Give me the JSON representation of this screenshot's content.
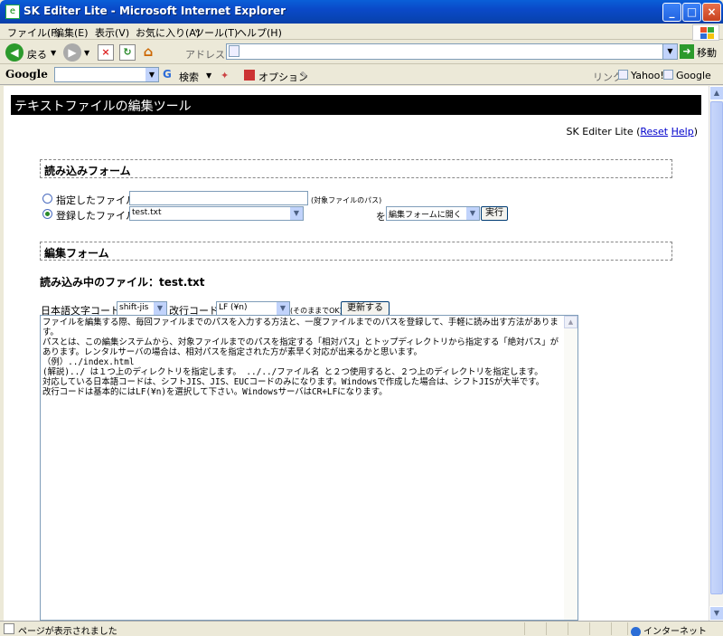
{
  "window": {
    "title": "SK Editer Lite - Microsoft Internet Explorer"
  },
  "menu": [
    "ファイル(F)",
    "編集(E)",
    "表示(V)",
    "お気に入り(A)",
    "ツール(T)",
    "ヘルプ(H)"
  ],
  "toolbar": {
    "back_label": "戻る",
    "address_label": "アドレス(D)",
    "go_label": "移動"
  },
  "google_bar": {
    "logo": "Google",
    "search_label": "検索",
    "options_label": "オプション",
    "links_label": "リンク",
    "link_yahoo": "Yahoo!",
    "link_google": "Google"
  },
  "page": {
    "banner": "テキストファイルの編集ツール",
    "credit_prefix": "SK Editer Lite (",
    "reset_link": "Reset",
    "help_link": "Help",
    "credit_suffix": ")",
    "read_form_title": "読み込みフォーム",
    "specified_file_label": "指定したファイル",
    "specified_file_value": "",
    "target_path_hint": "(対象ファイルのパス)",
    "registered_file_label": "登録したファイル",
    "registered_file_value": "test.txt",
    "wo_label": "を",
    "action_select_value": "編集フォームに開く",
    "execute_button": "実行",
    "edit_form_title": "編集フォーム",
    "loading_file_label": "読み込み中のファイル：test.txt",
    "charset_label": "日本語文字コード",
    "charset_value": "shift-jis",
    "newline_label": "改行コード",
    "newline_value": "LF (¥n)",
    "keep_note": "(そのままでOK)",
    "update_button": "更新する",
    "textarea_content": "ファイルを編集する際、毎回ファイルまでのパスを入力する方法と、一度ファイルまでのパスを登録して、手軽に読み出す方法があります。\nパスとは、この編集システムから、対象ファイルまでのパスを指定する「相対パス」とトップディレクトリから指定する「絶対パス」があります。レンタルサーバの場合は、相対パスを指定された方が素早く対応が出来るかと思います。\n（例）../index.html\n(解説)../ は１つ上のディレクトリを指定します。 ../../ファイル名 と２つ使用すると、２つ上のディレクトリを指定します。\n対応している日本語コードは、シフトJIS、JIS、EUCコードのみになります。Windowsで作成した場合は、シフトJISが大半です。\n改行コードは基本的にはLF(¥n)を選択して下さい。WindowsサーバはCR+LFになります。"
  },
  "status": {
    "text": "ページが表示されました",
    "zone": "インターネット"
  }
}
